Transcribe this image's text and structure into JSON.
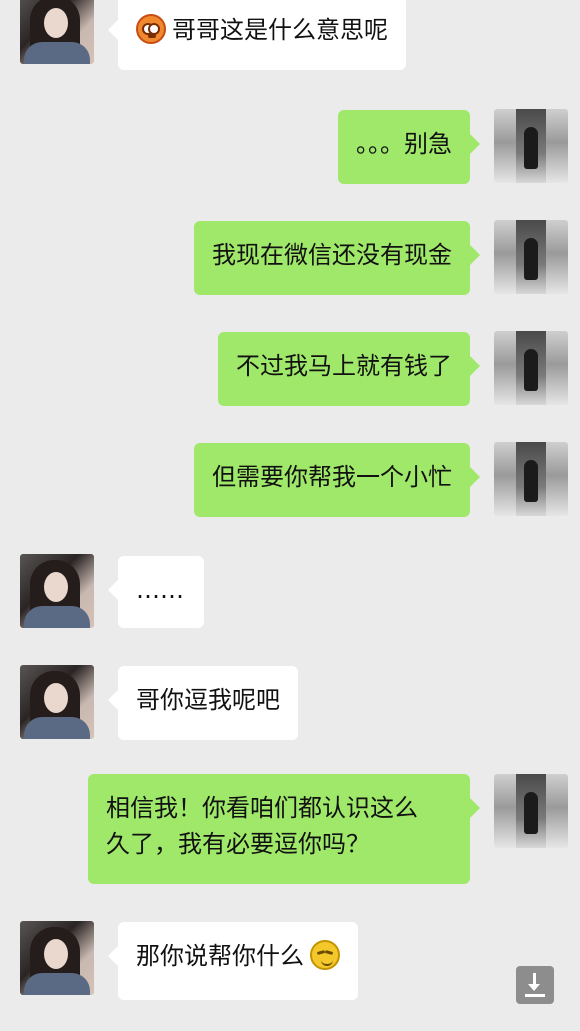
{
  "messages": [
    {
      "from": "other",
      "text": "哥哥这是什么意思呢",
      "emoji_before": "flushed-face"
    },
    {
      "from": "me",
      "text": "。。。别急"
    },
    {
      "from": "me",
      "text": "我现在微信还没有现金"
    },
    {
      "from": "me",
      "text": "不过我马上就有钱了"
    },
    {
      "from": "me",
      "text": "但需要你帮我一个小忙"
    },
    {
      "from": "other",
      "text": "……"
    },
    {
      "from": "other",
      "text": "哥你逗我呢吧"
    },
    {
      "from": "me",
      "text_line1": "相信我！你看咱们都认识这么",
      "text_line2": "久了，我有必要逗你吗？"
    },
    {
      "from": "other",
      "text": "那你说帮你什么",
      "emoji_after": "smirk-face"
    }
  ],
  "icons": {
    "download": "download-icon"
  },
  "colors": {
    "background": "#ebebeb",
    "incoming_bubble": "#ffffff",
    "outgoing_bubble": "#9fe86a"
  }
}
